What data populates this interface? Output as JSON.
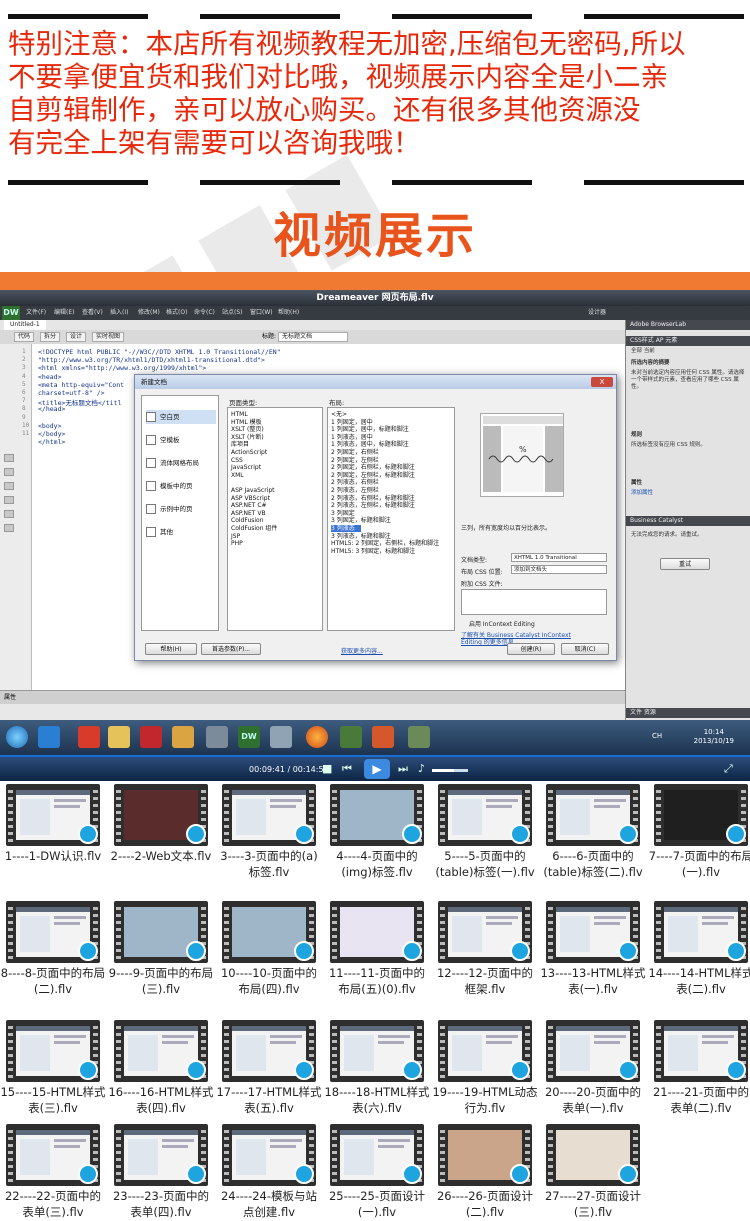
{
  "notice": {
    "lines": [
      "特别注意：本店所有视频教程无加密,压缩包无密码,所以",
      "不要拿便宜货和我们对比哦，视频展示内容全是小二亲",
      "自剪辑制作，亲可以放心购买。还有很多其他资源没",
      "有完全上架有需要可以咨询我哦！"
    ],
    "color": "#e8280a"
  },
  "section_title": "视频展示",
  "dreamweaver": {
    "window_title": "Dreameaver 网页布局.flv",
    "logo": "DW",
    "menu": [
      "文件(F)",
      "编辑(E)",
      "查看(V)",
      "插入(I)",
      "修改(M)",
      "格式(O)",
      "命令(C)",
      "站点(S)",
      "窗口(W)",
      "帮助(H)"
    ],
    "document_tab": "Untitled-1",
    "toolbar": {
      "code": "代码",
      "split": "拆分",
      "design": "设计",
      "live_view": "实时视图",
      "title_label": "标题:",
      "title_value": "无标题文档"
    },
    "layout_menu": "设计器",
    "code_lines": [
      "<!DOCTYPE html PUBLIC \"-//W3C//DTD XHTML 1.0 Transitional//EN\"",
      "\"http://www.w3.org/TR/xhtml1/DTD/xhtml1-transitional.dtd\">",
      "<html xmlns=\"http://www.w3.org/1999/xhtml\">",
      "<head>",
      "<meta http-equiv=\"Cont",
      "charset=utf-8\" />",
      "<title>无标题文档</titl",
      "</head>",
      "",
      "<body>",
      "</body>",
      "</html>"
    ],
    "line_numbers": [
      "1",
      "2",
      "3",
      "4",
      "5",
      "6",
      "7",
      "8",
      "9",
      "10",
      "11"
    ],
    "right_panel": {
      "adobe": "Adobe BrowserLab",
      "css_tabs": "CSS样式  AP 元素",
      "current": "全部  当前",
      "rules_title": "所选内容的摘要",
      "rules_text": "未对当前选定内容应用任何 CSS 属性。请选择一个带样式的元素，查看应用了哪些 CSS 属性。",
      "rules_head": "规则",
      "rules_text2": "所选标签没有应用 CSS 规则。",
      "props_head": "属性",
      "props_add": "添加属性",
      "bc_head": "Business Catalyst",
      "bc_text": "无法完成您的请求。请重试。",
      "bc_btn": "重试",
      "files_tabs": "文件  资源"
    },
    "props_bar": "属性",
    "dialog": {
      "title": "新建文档",
      "close": "X",
      "categories": [
        "空白页",
        "空模板",
        "流体网格布局",
        "模板中的页",
        "示例中的页",
        "其他"
      ],
      "page_type_head": "页面类型:",
      "page_types": [
        "HTML",
        "HTML 模板",
        "XSLT (整页)",
        "XSLT (片断)",
        "库项目",
        "ActionScript",
        "CSS",
        "JavaScript",
        "XML",
        "",
        "ASP JavaScript",
        "ASP VBScript",
        "ASP.NET C#",
        "ASP.NET VB",
        "ColdFusion",
        "ColdFusion 组件",
        "JSP",
        "PHP"
      ],
      "layout_head": "布局:",
      "layouts": [
        "<无>",
        "1 列固定，居中",
        "1 列固定，居中，标题和脚注",
        "1 列液态，居中",
        "1 列液态，居中，标题和脚注",
        "2 列固定，右侧栏",
        "2 列固定，左侧栏",
        "2 列固定，右侧栏，标题和脚注",
        "2 列固定，左侧栏，标题和脚注",
        "2 列液态，右侧栏",
        "2 列液态，左侧栏",
        "2 列液态，右侧栏，标题和脚注",
        "2 列液态，左侧栏，标题和脚注",
        "3 列固定",
        "3 列固定，标题和脚注",
        "3 列液态",
        "3 列液态，标题和脚注",
        "HTML5: 2 列固定，右侧栏，标题和脚注",
        "HTML5: 3 列固定，标题和脚注"
      ],
      "selected_layout_index": 15,
      "description": "三列，所有宽度均以百分比表示。",
      "doctype_label": "文档类型:",
      "doctype_value": "XHTML 1.0 Transitional",
      "layout_css_label": "布局 CSS 位置:",
      "layout_css_value": "添加到文档头",
      "attach_css_label": "附加 CSS 文件:",
      "incontext": "启用 InContext Editing",
      "link1": "了解有关 Business Catalyst InContext",
      "link2": "Editing 的更多信息",
      "help_btn": "帮助(H)",
      "pref_btn": "首选参数(P)...",
      "more_link": "获取更多内容...",
      "create_btn": "创建(R)",
      "cancel_btn": "取消(C)"
    },
    "clock_time": "10:14",
    "clock_date": "2013/10/19",
    "tray": "CH"
  },
  "player": {
    "time": "00:09:41 / 00:14:53",
    "volume_percent": 60
  },
  "thumbnails": [
    {
      "label": "1----1-DW认识.flv",
      "style": "ui"
    },
    {
      "label": "2----2-Web文本.flv",
      "style": "remark"
    },
    {
      "label": "3----3-页面中的(a)标签.flv",
      "style": "ui"
    },
    {
      "label": "4----4-页面中的(img)标签.flv",
      "style": "photo"
    },
    {
      "label": "5----5-页面中的(table)标签(一).flv",
      "style": "ui"
    },
    {
      "label": "6----6-页面中的(table)标签(二).flv",
      "style": "ui"
    },
    {
      "label": "7----7-页面中的布局(一).flv",
      "style": "dark"
    },
    {
      "label": "8----8-页面中的布局(二).flv",
      "style": "ui"
    },
    {
      "label": "9----9-页面中的布局(三).flv",
      "style": "photo"
    },
    {
      "label": "10----10-页面中的布局(四).flv",
      "style": "photo"
    },
    {
      "label": "11----11-页面中的布局(五)(0).flv",
      "style": "color"
    },
    {
      "label": "12----12-页面中的框架.flv",
      "style": "ui"
    },
    {
      "label": "13----13-HTML样式表(一).flv",
      "style": "ui"
    },
    {
      "label": "14----14-HTML样式表(二).flv",
      "style": "ui"
    },
    {
      "label": "15----15-HTML样式表(三).flv",
      "style": "ui"
    },
    {
      "label": "16----16-HTML样式表(四).flv",
      "style": "ui"
    },
    {
      "label": "17----17-HTML样式表(五).flv",
      "style": "ui"
    },
    {
      "label": "18----18-HTML样式表(六).flv",
      "style": "ui"
    },
    {
      "label": "19----19-HTML动态行为.flv",
      "style": "ui"
    },
    {
      "label": "20----20-页面中的表单(一).flv",
      "style": "ui"
    },
    {
      "label": "21----21-页面中的表单(二).flv",
      "style": "ui"
    },
    {
      "label": "22----22-页面中的表单(三).flv",
      "style": "ui"
    },
    {
      "label": "23----23-页面中的表单(四).flv",
      "style": "ui"
    },
    {
      "label": "24----24-模板与站点创建.flv",
      "style": "ui"
    },
    {
      "label": "25----25-页面设计(一).flv",
      "style": "ui"
    },
    {
      "label": "26----26-页面设计(二).flv",
      "style": "sky"
    },
    {
      "label": "27----27-页面设计(三).flv",
      "style": "warm"
    }
  ],
  "colors": {
    "accent": "#e9541d",
    "bar": "#f07a32",
    "badge": "#1ea5e0"
  }
}
